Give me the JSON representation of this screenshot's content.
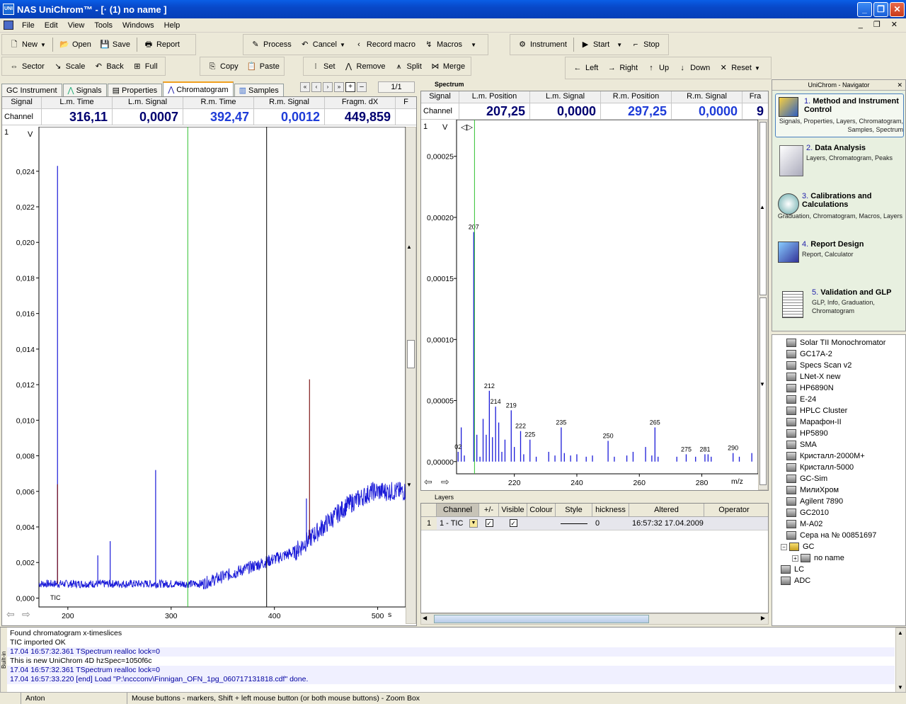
{
  "title": "NAS UniChrom™ - [· (1) no name ]",
  "menu": [
    "File",
    "Edit",
    "View",
    "Tools",
    "Windows",
    "Help"
  ],
  "toolbar1": {
    "new": "New",
    "open": "Open",
    "save": "Save",
    "report": "Report",
    "process": "Process",
    "cancel": "Cancel",
    "record": "Record macro",
    "macros": "Macros",
    "instrument": "Instrument",
    "start": "Start",
    "stop": "Stop"
  },
  "toolbar2": {
    "sector": "Sector",
    "scale": "Scale",
    "back": "Back",
    "full": "Full",
    "copy": "Copy",
    "paste": "Paste",
    "set": "Set",
    "remove": "Remove",
    "split": "Split",
    "merge": "Merge",
    "left": "Left",
    "right": "Right",
    "up": "Up",
    "down": "Down",
    "reset": "Reset"
  },
  "tabs": [
    "GC Instrument",
    "Signals",
    "Properties",
    "Chromatogram",
    "Samples"
  ],
  "page_counter": "1/1",
  "chrom_header": {
    "cols": [
      "Signal",
      "L.m. Time",
      "L.m. Signal",
      "R.m. Time",
      "R.m. Signal",
      "Fragm. dX",
      "F"
    ],
    "row_label": "Channel 1",
    "values": [
      "316,11",
      "0,0007",
      "392,47",
      "0,0012",
      "449,859"
    ]
  },
  "spectrum_header": {
    "section": "Spectrum",
    "cols": [
      "Signal",
      "L.m. Position",
      "L.m. Signal",
      "R.m. Position",
      "R.m. Signal",
      "Fra"
    ],
    "row_label": "Channel 1",
    "values": [
      "207,25",
      "0,0000",
      "297,25",
      "0,0000",
      "9"
    ]
  },
  "chart_data": [
    {
      "type": "line",
      "title": "",
      "series_label": "TIC",
      "ylabel": "V",
      "xlabel": "s",
      "xlim": [
        172,
        527
      ],
      "ylim": [
        -0.0005,
        0.0265
      ],
      "xticks": [
        200,
        300,
        400,
        500
      ],
      "yticks": [
        "0,000",
        "0,002",
        "0,004",
        "0,006",
        "0,008",
        "0,010",
        "0,012",
        "0,014",
        "0,016",
        "0,018",
        "0,020",
        "0,022",
        "0,024"
      ],
      "markers": {
        "left": 316.11,
        "right": 392.47
      },
      "peaks": [
        {
          "x": 190,
          "y": 0.0243
        },
        {
          "x": 190,
          "y": 0.0064
        },
        {
          "x": 285,
          "y": 0.0072
        },
        {
          "x": 434,
          "y": 0.0123
        },
        {
          "x": 431,
          "y": 0.0056
        },
        {
          "x": 241,
          "y": 0.0032
        },
        {
          "x": 229,
          "y": 0.0024
        }
      ]
    },
    {
      "type": "bar",
      "title": "",
      "ylabel": "V",
      "xlabel": "m/z",
      "xlim": [
        201.5,
        298
      ],
      "ylim": [
        -1e-05,
        0.00028
      ],
      "xticks": [
        220,
        240,
        260,
        280
      ],
      "yticks": [
        "0,00000",
        "0,00005",
        "0,00010",
        "0,00015",
        "0,00020",
        "0,00025"
      ],
      "marker_left": 207.25,
      "x": [
        202,
        203,
        204,
        207,
        208,
        209,
        210,
        211,
        212,
        213,
        214,
        215,
        216,
        217,
        219,
        220,
        222,
        223,
        225,
        227,
        231,
        233,
        235,
        236,
        238,
        240,
        243,
        245,
        250,
        252,
        256,
        258,
        262,
        264,
        265,
        266,
        272,
        275,
        278,
        281,
        282,
        283,
        290,
        292,
        296
      ],
      "values": [
        8e-06,
        2.8e-05,
        5e-06,
        0.000188,
        2.2e-05,
        4e-06,
        3.5e-05,
        2.2e-05,
        5.8e-05,
        2e-05,
        4.5e-05,
        3.2e-05,
        8e-06,
        1.8e-05,
        4.2e-05,
        1.2e-05,
        2.5e-05,
        6e-06,
        1.8e-05,
        4e-06,
        8e-06,
        5e-06,
        2.8e-05,
        7e-06,
        5e-06,
        6e-06,
        4e-06,
        5e-06,
        1.7e-05,
        4e-06,
        5e-06,
        8e-06,
        1.2e-05,
        5e-06,
        2.8e-05,
        4e-06,
        4e-06,
        6e-06,
        4e-06,
        6e-06,
        6e-06,
        4e-06,
        7e-06,
        4e-06,
        7e-06
      ],
      "labels": [
        {
          "x": 202,
          "text": "02"
        },
        {
          "x": 207,
          "text": "207"
        },
        {
          "x": 212,
          "text": "212"
        },
        {
          "x": 214,
          "text": "214"
        },
        {
          "x": 219,
          "text": "219"
        },
        {
          "x": 222,
          "text": "222"
        },
        {
          "x": 225,
          "text": "225"
        },
        {
          "x": 235,
          "text": "235"
        },
        {
          "x": 250,
          "text": "250"
        },
        {
          "x": 265,
          "text": "265"
        },
        {
          "x": 275,
          "text": "275"
        },
        {
          "x": 281,
          "text": "281"
        },
        {
          "x": 290,
          "text": "290"
        }
      ]
    }
  ],
  "layers": {
    "section": "Layers",
    "cols": [
      "Channel",
      "+/-",
      "Visible",
      "Colour",
      "Style",
      "hickness",
      "Altered",
      "Operator"
    ],
    "row": {
      "num": "1",
      "channel": "1 - TIC",
      "thickness": "0",
      "altered": "16:57:32 17.04.2009"
    }
  },
  "navigator": {
    "title": "UniChrom - Navigator",
    "items": [
      {
        "num": "1.",
        "title": "Method and Instrument Control",
        "sub": "Signals, Properties, Layers, Chromatogram, Samples, Spectrum"
      },
      {
        "num": "2.",
        "title": "Data Analysis",
        "sub": "Layers, Chromatogram, Peaks"
      },
      {
        "num": "3.",
        "title": "Calibrations and Calculations",
        "sub": "Graduation, Chromatogram, Macros, Layers"
      },
      {
        "num": "4.",
        "title": "Report Design",
        "sub": "Report, Calculator"
      },
      {
        "num": "5.",
        "title": "Validation and GLP",
        "sub": "GLP, Info, Graduation, Chromatogram"
      }
    ]
  },
  "tree": [
    "Solar TII Monochromator",
    "GC17A-2",
    "Specs Scan v2",
    "LNet-X new",
    "HP6890N",
    "E-24",
    "HPLC Cluster",
    "Марафон-II",
    "HP5890",
    "SMA",
    "Кристалл-2000М+",
    "Кристалл-5000",
    "GC-Sim",
    "МилиХром",
    "Agilent 7890",
    "GC2010",
    "М-A02",
    "Сера на № 00851697",
    "GC",
    "no name",
    "LC",
    "ADC"
  ],
  "log": {
    "side_label": "Built-in",
    "lines": [
      {
        "text": "Found chromatogram x-timeslices",
        "blue": false
      },
      {
        "text": "TIC imported OK",
        "blue": false
      },
      {
        "text": "17.04 16:57:32.361 TSpectrum realloc lock=0",
        "blue": true
      },
      {
        "text": "This is new UniChrom 4D hzSpec=1050f6c",
        "blue": false
      },
      {
        "text": "17.04 16:57:32.361 TSpectrum realloc lock=0",
        "blue": true
      },
      {
        "text": "17.04 16:57:33.220 [end] Load \"P:\\nccconv\\Finnigan_OFN_1pg_060717131818.cdf\" done.",
        "blue": true
      }
    ]
  },
  "status": {
    "user": "Anton",
    "hint": "Mouse buttons - markers, Shift + left mouse button (or both mouse buttons) - Zoom Box"
  }
}
